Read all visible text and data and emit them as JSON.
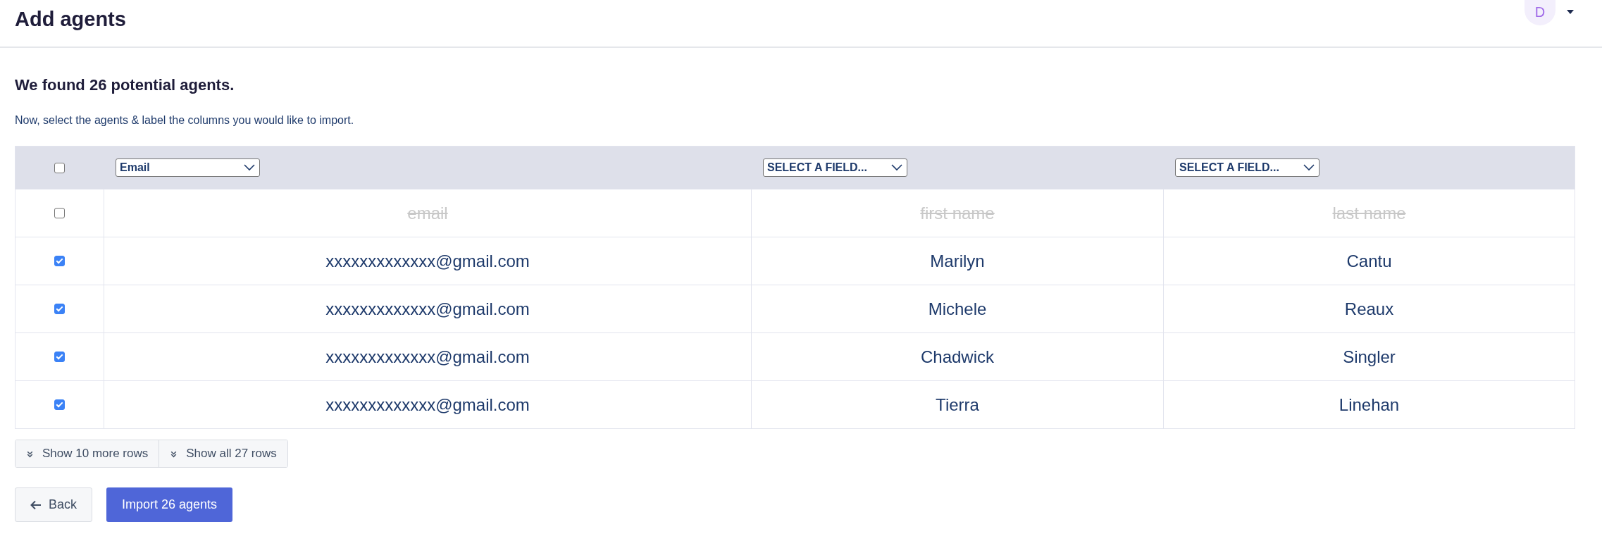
{
  "page_title": "Add agents",
  "user": {
    "initial": "D"
  },
  "heading": "We found 26 potential agents.",
  "instructions": "Now, select the agents & label the columns you would like to import.",
  "table": {
    "select_all_checked": false,
    "columns": [
      "Email",
      "SELECT A FIELD...",
      "SELECT A FIELD..."
    ],
    "rows": [
      {
        "checked": false,
        "cells": [
          "email",
          "first name",
          "last name"
        ]
      },
      {
        "checked": true,
        "cells": [
          "xxxxxxxxxxxxx@gmail.com",
          "Marilyn",
          "Cantu"
        ]
      },
      {
        "checked": true,
        "cells": [
          "xxxxxxxxxxxxx@gmail.com",
          "Michele",
          "Reaux"
        ]
      },
      {
        "checked": true,
        "cells": [
          "xxxxxxxxxxxxx@gmail.com",
          "Chadwick",
          "Singler"
        ]
      },
      {
        "checked": true,
        "cells": [
          "xxxxxxxxxxxxx@gmail.com",
          "Tierra",
          "Linehan"
        ]
      }
    ]
  },
  "row_buttons": [
    "Show 10 more rows",
    "Show all 27 rows"
  ],
  "back_button": "Back",
  "import_button": "Import 26 agents"
}
